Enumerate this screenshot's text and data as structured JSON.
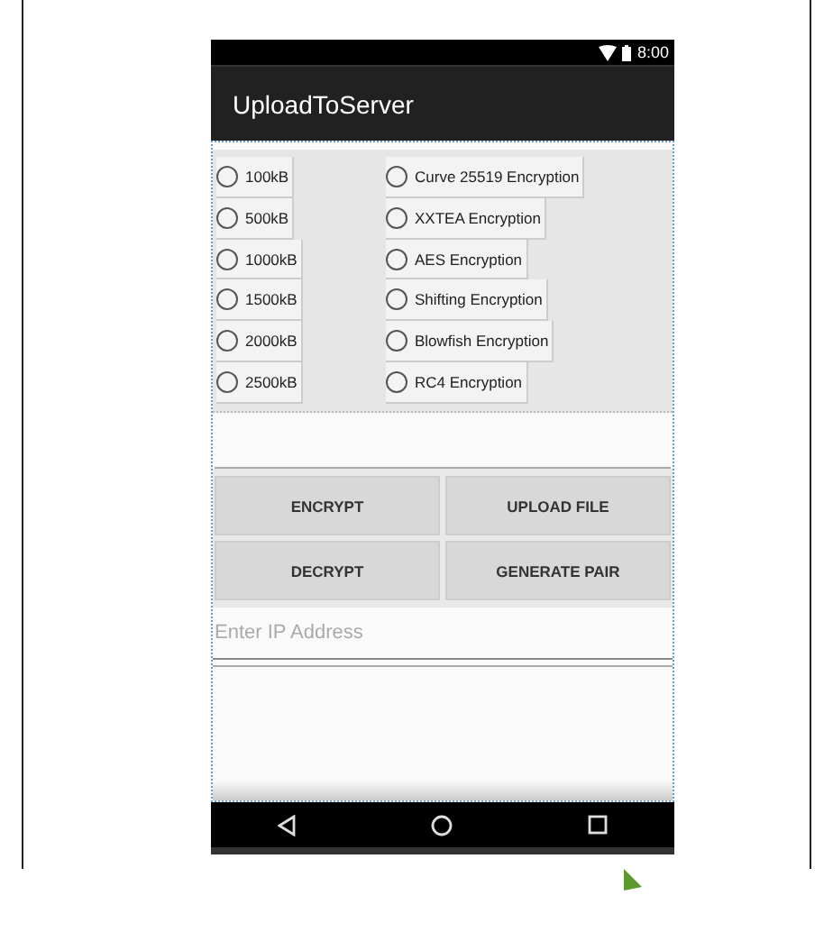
{
  "status_bar": {
    "time": "8:00"
  },
  "app_bar": {
    "title": "UploadToServer"
  },
  "size_options": [
    {
      "label": "100kB",
      "selected": false
    },
    {
      "label": "500kB",
      "selected": false
    },
    {
      "label": "1000kB",
      "selected": false
    },
    {
      "label": "1500kB",
      "selected": false
    },
    {
      "label": "2000kB",
      "selected": false
    },
    {
      "label": "2500kB",
      "selected": false
    }
  ],
  "encryption_options": [
    {
      "label": "Curve 25519 Encryption",
      "selected": false
    },
    {
      "label": "XXTEA Encryption",
      "selected": false
    },
    {
      "label": "AES Encryption",
      "selected": false
    },
    {
      "label": "Shifting Encryption",
      "selected": false
    },
    {
      "label": "Blowfish Encryption",
      "selected": false
    },
    {
      "label": "RC4 Encryption",
      "selected": false
    }
  ],
  "buttons": [
    {
      "label": "ENCRYPT"
    },
    {
      "label": "UPLOAD FILE"
    },
    {
      "label": "DECRYPT"
    },
    {
      "label": "GENERATE PAIR"
    }
  ],
  "ip_field": {
    "placeholder": "Enter IP Address"
  }
}
